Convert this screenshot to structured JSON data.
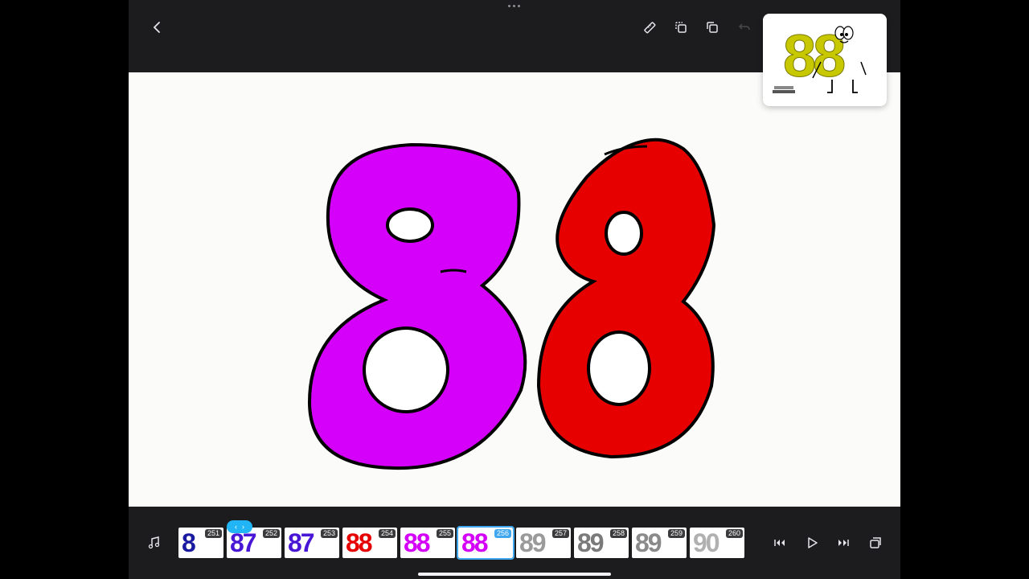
{
  "topbar": {
    "icons": [
      "back-icon",
      "ruler-icon",
      "copy-frame-icon",
      "duplicate-icon",
      "undo-icon"
    ]
  },
  "onion_skin": {
    "title_text": "88"
  },
  "canvas": {
    "digits": [
      {
        "char": "8",
        "color": "#d500f9"
      },
      {
        "char": "8",
        "color": "#e60000"
      }
    ]
  },
  "timeline": {
    "frames": [
      {
        "number": "251",
        "glyph": "8",
        "color": "#1a1aa0"
      },
      {
        "number": "252",
        "glyph": "87",
        "color": "#4a16d6"
      },
      {
        "number": "253",
        "glyph": "87",
        "color": "#4a16d6"
      },
      {
        "number": "254",
        "glyph": "88",
        "color": "#e60000"
      },
      {
        "number": "255",
        "glyph": "88",
        "color": "#d500f9"
      },
      {
        "number": "256",
        "glyph": "88",
        "color": "#d500f9"
      },
      {
        "number": "257",
        "glyph": "89",
        "color": "#9a9a9a"
      },
      {
        "number": "258",
        "glyph": "89",
        "color": "#7a7a7a"
      },
      {
        "number": "259",
        "glyph": "89",
        "color": "#8a8a8a"
      },
      {
        "number": "260",
        "glyph": "90",
        "color": "#b0b0b0"
      }
    ],
    "current_frame": "256",
    "playhead_icons": [
      "chevron-left-icon",
      "chevron-right-icon"
    ]
  },
  "controls": {
    "icons": [
      "music-icon",
      "skip-back-icon",
      "play-icon",
      "skip-forward-icon",
      "add-frame-icon"
    ]
  }
}
